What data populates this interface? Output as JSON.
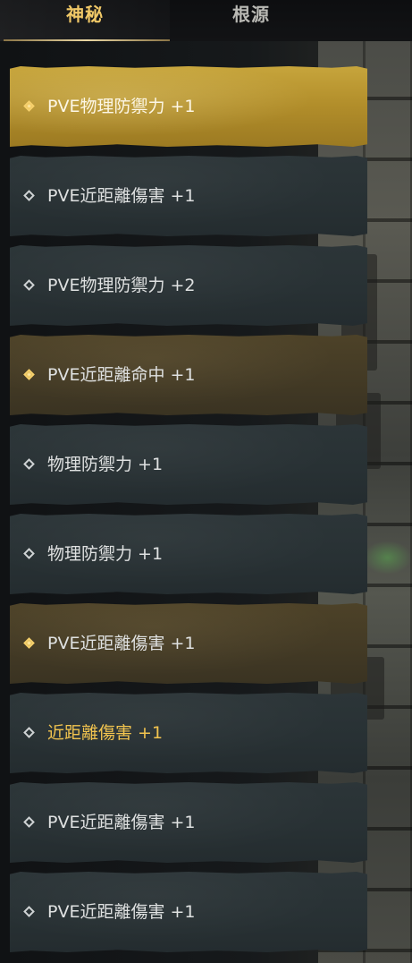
{
  "tabs": [
    {
      "label": "神秘",
      "active": true
    },
    {
      "label": "根源",
      "active": false
    }
  ],
  "rewards": [
    {
      "label": "PVE物理防禦力 +1",
      "style": "gold",
      "label_color": "light"
    },
    {
      "label": "PVE近距離傷害 +1",
      "style": "slate",
      "label_color": "light"
    },
    {
      "label": "PVE物理防禦力 +2",
      "style": "slate",
      "label_color": "light"
    },
    {
      "label": "PVE近距離命中 +1",
      "style": "bronze",
      "label_color": "light"
    },
    {
      "label": "物理防禦力 +1",
      "style": "slate",
      "label_color": "light"
    },
    {
      "label": "物理防禦力 +1",
      "style": "slate",
      "label_color": "light"
    },
    {
      "label": "PVE近距離傷害 +1",
      "style": "bronze",
      "label_color": "light"
    },
    {
      "label": "近距離傷害 +1",
      "style": "slate",
      "label_color": "yellow"
    },
    {
      "label": "PVE近距離傷害 +1",
      "style": "slate",
      "label_color": "light"
    },
    {
      "label": "PVE近距離傷害 +1",
      "style": "slate",
      "label_color": "light"
    }
  ],
  "colors": {
    "active_tab": "#f0c867",
    "gold_row": "#b8942f",
    "bronze_row": "#453b26",
    "slate_row": "#293234",
    "highlight_text": "#f2c44f"
  },
  "icons": {
    "row_marker": "diamond-icon"
  }
}
